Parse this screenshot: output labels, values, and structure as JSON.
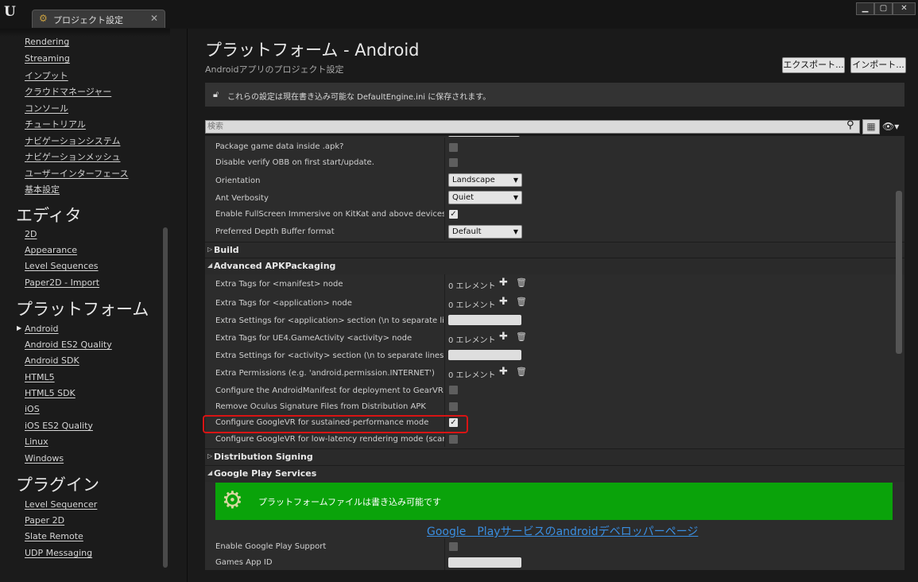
{
  "window": {
    "tab_title": "プロジェクト設定",
    "tab_close": "✕",
    "min": "▁",
    "max": "▢",
    "close": "✕"
  },
  "sidebar": {
    "top_items": [
      "Rendering",
      "Streaming",
      "インプット",
      "クラウドマネージャー",
      "コンソール",
      "チュートリアル",
      "ナビゲーションシステム",
      "ナビゲーションメッシュ",
      "ユーザーインターフェース",
      "基本設定"
    ],
    "section_editor": "エディタ",
    "editor_items": [
      "2D",
      "Appearance",
      "Level Sequences",
      "Paper2D - Import"
    ],
    "section_platform": "プラットフォーム",
    "platform_items": [
      "Android",
      "Android ES2 Quality",
      "Android SDK",
      "HTML5",
      "HTML5 SDK",
      "iOS",
      "iOS ES2 Quality",
      "Linux",
      "Windows"
    ],
    "section_plugins": "プラグイン",
    "plugin_items": [
      "Level Sequencer",
      "Paper 2D",
      "Slate Remote",
      "UDP Messaging"
    ]
  },
  "header": {
    "title": "プラットフォーム - Android",
    "subtitle": "Androidアプリのプロジェクト設定",
    "export_label": "エクスポート...",
    "import_label": "インポート..."
  },
  "notice": "これらの設定は現在書き込み可能な DefaultEngine.ini に保存されます。",
  "search": {
    "placeholder": "検索"
  },
  "rows": {
    "package_apk": "Package game data inside .apk?",
    "disable_obb": "Disable verify OBB on first start/update.",
    "orientation": "Orientation",
    "orientation_value": "Landscape",
    "ant_verbosity": "Ant Verbosity",
    "ant_value": "Quiet",
    "fullscreen": "Enable FullScreen Immersive on KitKat and above devices.",
    "depth_buffer": "Preferred Depth Buffer format",
    "depth_value": "Default",
    "extra_manifest": "Extra Tags for <manifest> node",
    "extra_application": "Extra Tags for <application> node",
    "extra_settings_app": "Extra Settings for <application> section (\\n to separate lines)",
    "extra_gameactivity": "Extra Tags for UE4.GameActivity <activity> node",
    "extra_settings_activity": "Extra Settings for <activity> section (\\n to separate lines)",
    "extra_permissions": "Extra Permissions (e.g. 'android.permission.INTERNET')",
    "config_gearvr": "Configure the AndroidManifest for deployment to GearVR",
    "remove_oculus": "Remove Oculus Signature Files from Distribution APK",
    "googlevr_sustained": "Configure GoogleVR for sustained-performance mode",
    "googlevr_lowlatency": "Configure GoogleVR for low-latency rendering mode (scanline racing)",
    "enable_gplay": "Enable Google Play Support",
    "games_app_id": "Games App ID",
    "element_count": "0 エレメント"
  },
  "categories": {
    "build": "Build",
    "advanced": "Advanced APKPackaging",
    "distribution": "Distribution Signing",
    "gplay": "Google Play Services"
  },
  "gplay": {
    "banner_text": "プラットフォームファイルは書き込み可能です",
    "link_text": "Google　Playサービスのandroidデベロッパーページ"
  },
  "colors": {
    "highlight": "#d81414",
    "banner": "#0aa30a",
    "link": "#3a8ee0"
  }
}
